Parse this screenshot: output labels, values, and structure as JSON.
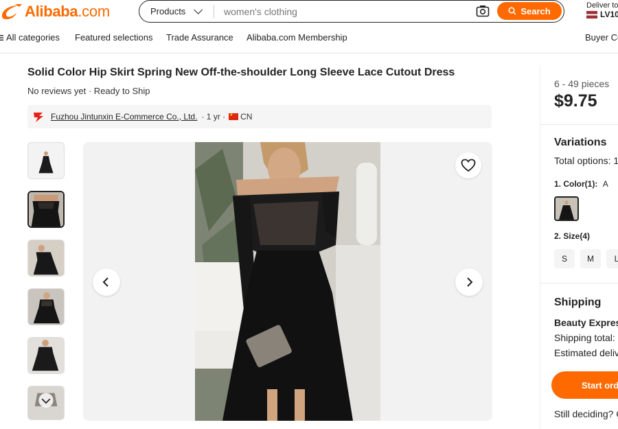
{
  "header": {
    "logo_text": "Alibaba",
    "logo_suffix": ".com",
    "search": {
      "category": "Products",
      "value": "women's clothing",
      "button": "Search"
    },
    "deliver": {
      "label": "Deliver to",
      "code": "LV10"
    }
  },
  "nav": {
    "items": [
      "All categories",
      "Featured selections",
      "Trade Assurance",
      "Alibaba.com Membership",
      "Buyer Ce"
    ]
  },
  "product": {
    "title": "Solid Color Hip Skirt Spring New Off-the-shoulder Long Sleeve Lace Cutout Dress",
    "reviews": "No reviews yet · Ready to Ship",
    "supplier": {
      "name": "Fuzhou Jintunxin E-Commerce Co., Ltd.",
      "years": "· 1 yr ·",
      "country": "CN"
    }
  },
  "panel": {
    "price_range": "6 - 49 pieces",
    "price": "$9.75",
    "variations_title": "Variations",
    "total_options": "Total options: 1",
    "color_label": "1. Color(1):",
    "color_value": "A",
    "size_label": "2. Size(4)",
    "sizes": [
      "S",
      "M",
      "L"
    ],
    "shipping_title": "Shipping",
    "shipping_method": "Beauty Expres",
    "shipping_total": "Shipping total:",
    "estimated": "Estimated deliv",
    "start_order": "Start orde",
    "still_deciding": "Still deciding? G"
  },
  "colors": {
    "brand": "#ff6a00",
    "text": "#222222"
  }
}
